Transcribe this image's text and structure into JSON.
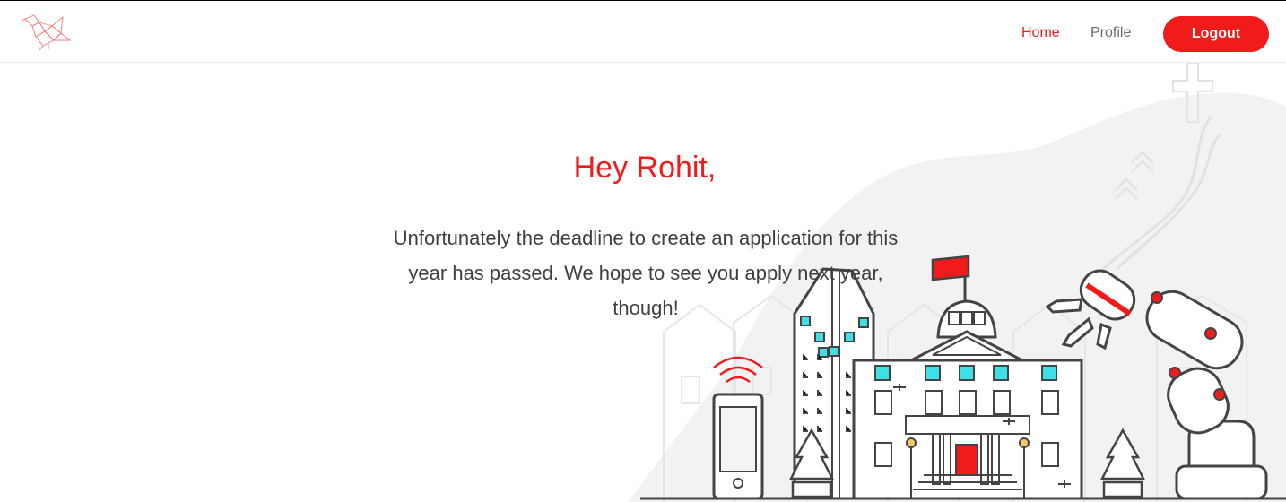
{
  "nav": {
    "home_label": "Home",
    "profile_label": "Profile",
    "logout_label": "Logout"
  },
  "main": {
    "greeting": "Hey Rohit,",
    "message": "Unfortunately the deadline to create an application for this year has passed. We hope to see you apply next year, though!"
  },
  "colors": {
    "accent": "#f21b1b",
    "text": "#3f3f3f",
    "muted": "#6b6b6b",
    "window_glass": "#3ee0e6"
  },
  "icons": [
    "bird-logo-icon",
    "smartphone-icon",
    "wifi-signal-icon",
    "flag-icon",
    "robot-arm-icon",
    "christmas-tree-icon"
  ]
}
